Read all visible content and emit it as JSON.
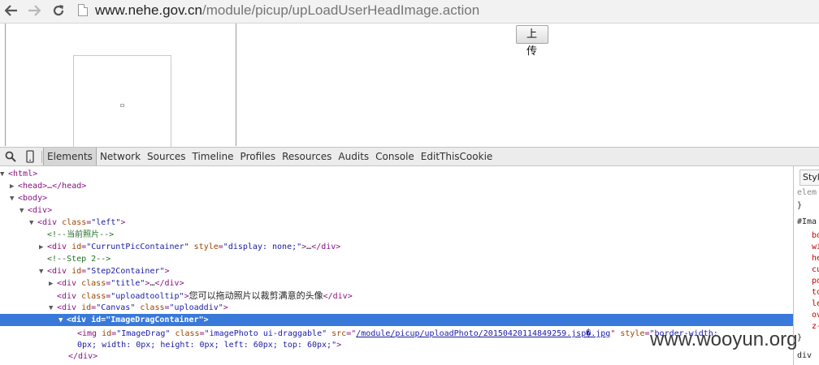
{
  "browser": {
    "url_host": "www.nehe.gov.cn",
    "url_path": "/module/picup/upLoadUserHeadImage.action"
  },
  "page": {
    "upload_button_label": "上 传"
  },
  "devtools": {
    "tabs": [
      "Elements",
      "Network",
      "Sources",
      "Timeline",
      "Profiles",
      "Resources",
      "Audits",
      "Console",
      "EditThisCookie"
    ],
    "active_tab": "Elements",
    "tree": {
      "html": "<html>",
      "head": "<head>…</head>",
      "body": "<body>",
      "div": "<div>",
      "div_left_open": "<div ",
      "div_left_attr": "class",
      "div_left_val": "\"left\"",
      "comment1": "<!--当前照片-->",
      "curpic_id": "\"CurruntPicContainer\"",
      "curpic_style": "\"display: none;\"",
      "comment2": "<!--Step 2-->",
      "step2_id": "\"Step2Container\"",
      "title_class": "\"title\"",
      "tooltip_class": "\"uploadtooltip\"",
      "tooltip_text": "您可以拖动照片以裁剪满意的头像",
      "canvas_id": "\"Canvas\"",
      "canvas_class": "\"uploaddiv\"",
      "drag_container_id": "\"ImageDragContainer\"",
      "img_id": "\"ImageDrag\"",
      "img_class": "\"imagePhoto ui-draggable\"",
      "img_src": "/module/picup/uploadPhoto/20150420114849259.jsp�.jpg",
      "img_style_a": "\"border-width:",
      "img_style_b": "0px; width: 0px; height: 0px; left: 60px; top: 60px;\"",
      "close_div": "</div>"
    },
    "styles": {
      "tab_label": "Styl",
      "line1": "elem",
      "line2": "}",
      "line3": "#Ima",
      "props": [
        "bo",
        "wi",
        "he",
        "cu",
        "po",
        "to",
        "le",
        "ov",
        "z-"
      ],
      "line_end": "}",
      "footer": "div"
    }
  },
  "watermark": "www.wooyun.org",
  "colors": {
    "selection": "#3879d9",
    "tag": "#881280",
    "attr_name": "#994500",
    "attr_value": "#1a1aa6",
    "comment": "#236e25"
  }
}
